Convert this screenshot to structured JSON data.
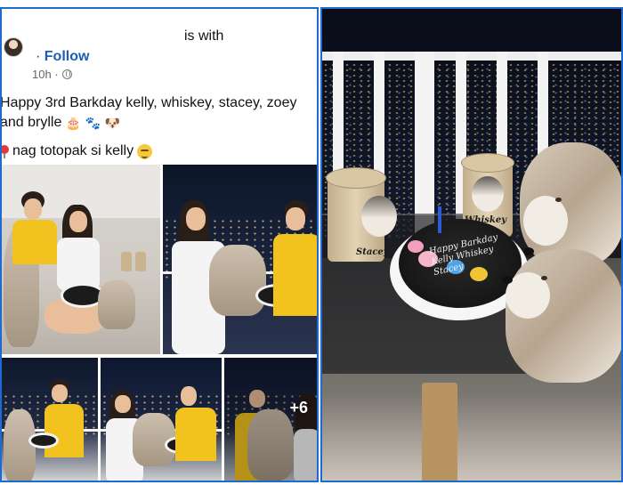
{
  "post": {
    "is_with": "is with",
    "follow_separator": "·",
    "follow_label": "Follow",
    "time": "10h ·",
    "caption": "Happy 3rd Barkday kelly, whiskey, stacey, zoey and brylle",
    "caption_emojis": [
      "🎂",
      "🐾",
      "🐶"
    ],
    "note": "nag totopak si kelly",
    "more_photos": "+6"
  },
  "cake_photo": {
    "cake_text": "Happy Barkday Kelly Whiskey Stacey",
    "jar_left_label": "Stacey",
    "jar_right_label": "Whiskey"
  },
  "colors": {
    "panel_border": "#1e6ad1",
    "follow_link": "#1b5fb4"
  },
  "icons": [
    "avatar",
    "globe-icon",
    "pin-icon",
    "sad-face-icon"
  ]
}
